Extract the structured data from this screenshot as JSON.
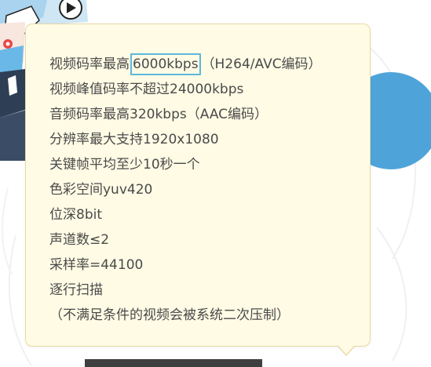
{
  "tooltip": {
    "line1": {
      "prefix": "视频码率最高",
      "highlight": "6000kbps",
      "suffix": "（H264/AVC编码）"
    },
    "lines": [
      "视频峰值码率不超过24000kbps",
      "音频码率最高320kbps（AAC编码）",
      "分辨率最大支持1920x1080",
      "关键帧平均至少10秒一个",
      "色彩空间yuv420",
      "位深8bit",
      "声道数≤2",
      "采样率=44100",
      "逐行扫描",
      "（不满足条件的视频会被系统二次压制）"
    ]
  },
  "colors": {
    "tooltip_background": "#fffbe5",
    "tooltip_border": "#e9d9a5",
    "highlight_border": "#5cb8dc",
    "text": "#4a4a4a",
    "accent_blue": "#4ea4d8"
  },
  "icons": {
    "mascot": "mascot-character-illustration",
    "play": "play-icon"
  }
}
